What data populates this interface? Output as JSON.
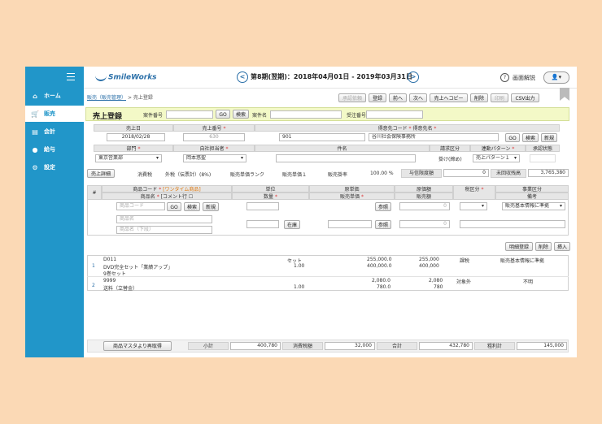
{
  "sidebar": {
    "items": [
      {
        "label": "ホーム",
        "icon": "home-icon"
      },
      {
        "label": "販売",
        "icon": "cart-icon"
      },
      {
        "label": "会計",
        "icon": "ledger-icon"
      },
      {
        "label": "給与",
        "icon": "moneybag-icon"
      },
      {
        "label": "設定",
        "icon": "gear-icon"
      }
    ],
    "active": "販売"
  },
  "topbar": {
    "logo": "SmileWorks",
    "period": "第8期(翌期)：2018年04月01日 - 2019年03月31日",
    "prev_symbol": "<",
    "next_symbol": ">",
    "help_label": "画面解説",
    "user_symbol": "👤▾"
  },
  "breadcrumb": {
    "parent": "販売（販売管理）",
    "sep": ">",
    "current": "売上登録"
  },
  "toolbar": {
    "approve": "承認依頼",
    "register": "登録",
    "prev": "前へ",
    "next": "次へ",
    "copy": "売上へコピー",
    "delete": "削除",
    "print": "印刷",
    "csv": "CSV出力"
  },
  "form": {
    "title": "売上登録",
    "case_no_label": "案件番号",
    "go": "GO",
    "search": "検索",
    "case_name_label": "案件名",
    "order_no_label": "受注番号",
    "headers": {
      "sales_date": "売上日",
      "sales_no": "売上番号",
      "customer": "得意先コード",
      "customer_name": "得意先名",
      "dept": "部門",
      "staff": "自社担当者",
      "subject": "件名",
      "billing": "請求区分",
      "linkage": "連動パターン",
      "approval": "承認状態"
    },
    "sales_date": "2018/02/28",
    "sales_no": "630",
    "customer_code": "901",
    "customer_name": "谷川社会保険事務所",
    "new": "新規",
    "dept": "東京営業部",
    "staff": "岡本悠聖",
    "billing": "掛け(締め)",
    "linkage": "売上パターン１"
  },
  "summary": {
    "detail_btn": "売上詳細",
    "tax_label": "消費税",
    "tax_value": "外税（伝票計）(8%)",
    "rank_label": "販売単価ランク",
    "rank_value": "販売単価１",
    "rate_label": "販売掛率",
    "rate_value": "100.00 %",
    "credit_label": "与信限度額",
    "credit_value": "0",
    "unpaid_label": "未回収残高",
    "unpaid_value": "3,765,380"
  },
  "detail_headers": {
    "num": "#",
    "product_code": "商品コード",
    "one_time": "[ワンタイム商品]",
    "product_name": "商品名",
    "comment": "[コメント行",
    "unit": "単位",
    "qty": "数量",
    "cost_price": "原単価",
    "sale_price": "販売単価",
    "cost_amount": "原価額",
    "sale_amount": "販売額",
    "tax_class": "税区分",
    "note": "備考",
    "business": "事業区分"
  },
  "detail_input": {
    "code_placeholder": "商品コード",
    "name_placeholder": "商品名",
    "name2_placeholder": "商品名（下段）",
    "go": "GO",
    "search": "検索",
    "new": "新規",
    "ref": "参照",
    "stock": "在庫",
    "ref2": "参照",
    "zero": "0",
    "tax_sel": "▾",
    "business": "販売基本情報に準拠"
  },
  "row_buttons": {
    "register": "明細登録",
    "delete": "削除",
    "insert": "挿入"
  },
  "rows": [
    {
      "num": "1",
      "code": "D011",
      "name1": "DVD完全セット「業績アップ」",
      "name2": "9巻セット",
      "unit": "セット",
      "qty": "1.00",
      "cost": "255,000.0",
      "price": "400,000.0",
      "cost_amt": "255,000",
      "sale_amt": "400,000",
      "tax": "課税",
      "business": "販売基本情報に準拠"
    },
    {
      "num": "2",
      "code": "9999",
      "name1": "送料（立替金）",
      "name2": "",
      "unit": "",
      "qty": "1.00",
      "cost": "2,080.0",
      "price": "780.0",
      "cost_amt": "2,080",
      "sale_amt": "780",
      "tax": "対象外",
      "business": "不明"
    }
  ],
  "footer": {
    "reacquire": "商品マスタより再取得",
    "subtotal_label": "小計",
    "subtotal": "400,780",
    "tax_label": "消費税額",
    "tax": "32,000",
    "total_label": "合計",
    "total": "432,780",
    "gross_label": "粗利計",
    "gross": "145,000"
  }
}
